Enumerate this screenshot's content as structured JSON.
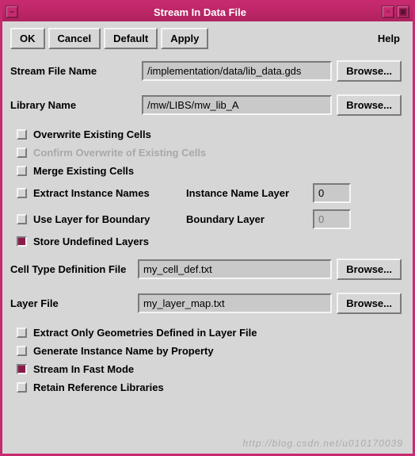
{
  "window": {
    "title": "Stream In Data File"
  },
  "buttons": {
    "ok": "OK",
    "cancel": "Cancel",
    "default": "Default",
    "apply": "Apply",
    "help": "Help",
    "browse": "Browse..."
  },
  "fields": {
    "stream_file": {
      "label": "Stream File Name",
      "value": "/implementation/data/lib_data.gds"
    },
    "library_name": {
      "label": "Library Name",
      "value": "/mw/LIBS/mw_lib_A"
    },
    "cell_type_def": {
      "label": "Cell Type Definition File",
      "value": "my_cell_def.txt"
    },
    "layer_file": {
      "label": "Layer File",
      "value": "my_layer_map.txt"
    },
    "instance_layer": {
      "label": "Instance Name Layer",
      "value": "0"
    },
    "boundary_layer": {
      "label": "Boundary Layer",
      "value": "0"
    }
  },
  "checks": {
    "overwrite": {
      "label": "Overwrite Existing Cells",
      "checked": false
    },
    "confirm_overwrite": {
      "label": "Confirm Overwrite of Existing Cells",
      "checked": false,
      "disabled": true
    },
    "merge": {
      "label": "Merge Existing Cells",
      "checked": false
    },
    "extract_instance": {
      "label": "Extract Instance Names",
      "checked": false
    },
    "use_layer_boundary": {
      "label": "Use Layer for Boundary",
      "checked": false
    },
    "store_undefined": {
      "label": "Store Undefined Layers",
      "checked": true
    },
    "extract_geom": {
      "label": "Extract Only Geometries Defined in Layer File",
      "checked": false
    },
    "gen_instance_prop": {
      "label": "Generate Instance Name by Property",
      "checked": false
    },
    "fast_mode": {
      "label": "Stream In Fast Mode",
      "checked": true
    },
    "retain_ref": {
      "label": "Retain Reference Libraries",
      "checked": false
    }
  },
  "watermark": "http://blog.csdn.net/u010170039"
}
